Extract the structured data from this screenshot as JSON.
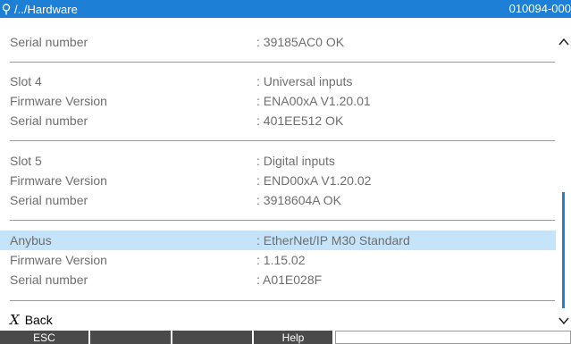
{
  "header": {
    "path": "/../Hardware",
    "device_id": "010094-000"
  },
  "rows": [
    {
      "label": "Serial number",
      "value": ": 39185AC0 OK"
    },
    {
      "label": "Slot 4",
      "value": ": Universal inputs"
    },
    {
      "label": "Firmware Version",
      "value": ": ENA00xA V1.20.01"
    },
    {
      "label": "Serial number",
      "value": ": 401EE512 OK"
    },
    {
      "label": "Slot 5",
      "value": ": Digital inputs"
    },
    {
      "label": "Firmware Version",
      "value": ": END00xA V1.20.02"
    },
    {
      "label": "Serial number",
      "value": ": 3918604A OK"
    },
    {
      "label": "Anybus",
      "value": ": EtherNet/IP  M30 Standard"
    },
    {
      "label": "Firmware Version",
      "value": ": 1.15.02"
    },
    {
      "label": "Serial number",
      "value": ": A01E028F"
    }
  ],
  "back": {
    "icon": "x-icon",
    "label": "Back"
  },
  "softkeys": [
    {
      "label": "ESC"
    },
    {
      "label": ""
    },
    {
      "label": ""
    },
    {
      "label": "Help"
    },
    {
      "label": ""
    }
  ],
  "colors": {
    "title_bar": "#1e7fd6",
    "selected_row": "#c5e4f9",
    "scrollbar_thumb": "#1e7fd6",
    "softkey": "#4a4a4a"
  }
}
